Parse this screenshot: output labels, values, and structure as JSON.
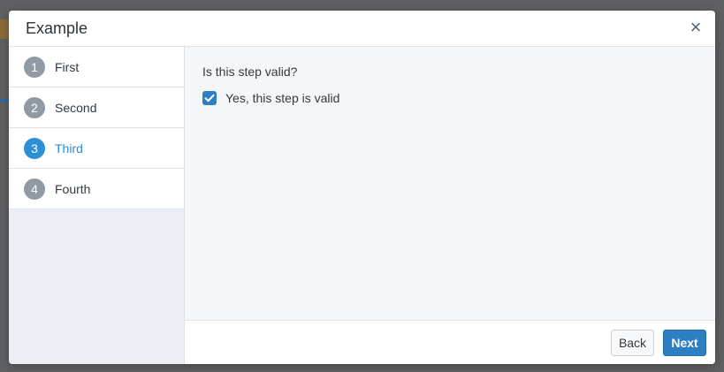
{
  "dialog": {
    "title": "Example",
    "close_glyph": "×"
  },
  "steps": [
    {
      "number": "1",
      "label": "First",
      "active": false
    },
    {
      "number": "2",
      "label": "Second",
      "active": false
    },
    {
      "number": "3",
      "label": "Third",
      "active": true
    },
    {
      "number": "4",
      "label": "Fourth",
      "active": false
    }
  ],
  "content": {
    "question": "Is this step valid?",
    "checkbox_label": "Yes, this step is valid",
    "checkbox_checked": true
  },
  "footer": {
    "back_label": "Back",
    "next_label": "Next"
  },
  "colors": {
    "accent": "#2d8fd5",
    "primary_button": "#2d7fc2",
    "inactive_step": "#909aa4"
  }
}
